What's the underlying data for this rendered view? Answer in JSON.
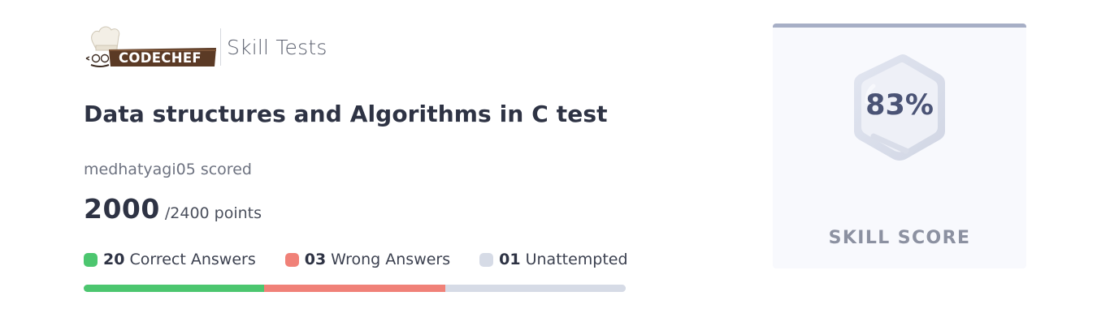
{
  "header": {
    "logo_text": "CODECHEF",
    "section_title": "Skill Tests"
  },
  "test": {
    "title": "Data structures and Algorithms in C test",
    "scored_line": "medhatyagi05 scored",
    "score": "2000",
    "total": "/2400 points"
  },
  "results": {
    "correct": {
      "count": "20",
      "label": "Correct Answers",
      "color": "#4cc66f",
      "value": 20
    },
    "wrong": {
      "count": "03",
      "label": "Wrong Answers",
      "color": "#f08178",
      "value": 20
    },
    "unattempted": {
      "count": "01",
      "label": "Unattempted",
      "color": "#d6dbe6",
      "value": 20
    }
  },
  "skill": {
    "value": "83%",
    "label": "SKILL SCORE"
  },
  "colors": {
    "title": "#2e3344",
    "card_top_border": "#a7afc6",
    "badge_text": "#4a5375"
  }
}
